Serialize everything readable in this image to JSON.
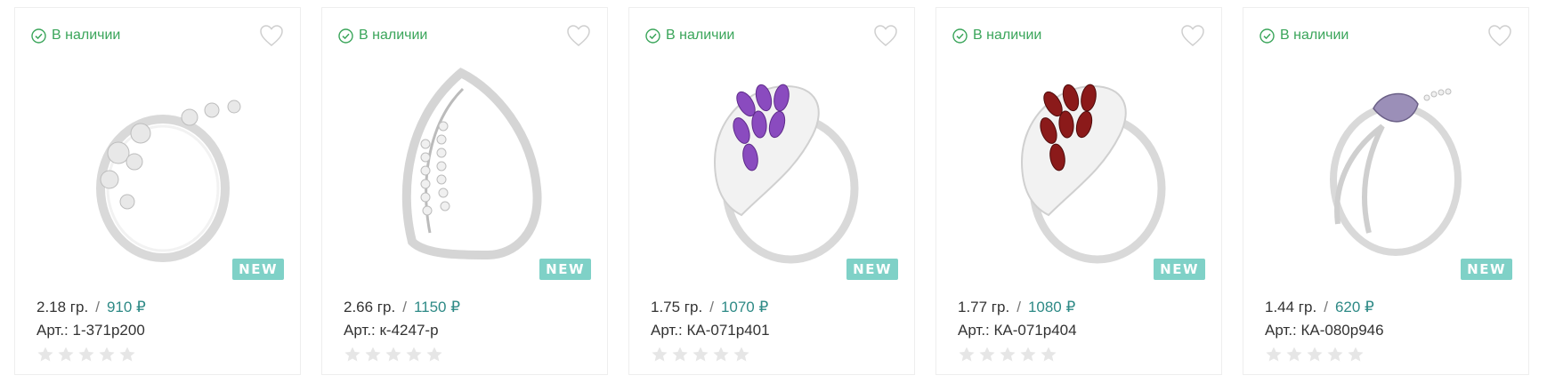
{
  "colors": {
    "in_stock": "#3aa55a",
    "price": "#2e8a86",
    "badge_bg": "#7fd1c7",
    "star_empty": "#e6e6e6"
  },
  "products": [
    {
      "stock": "В наличии",
      "badge": "NEW",
      "weight": "2.18 гр.",
      "separator": "/",
      "price": "910 ₽",
      "article": "Арт.: 1-371р200",
      "rating": 0,
      "stone_color": "#e8e8e8",
      "icon": "heart-icon"
    },
    {
      "stock": "В наличии",
      "badge": "NEW",
      "weight": "2.66 гр.",
      "separator": "/",
      "price": "1150 ₽",
      "article": "Арт.: к-4247-р",
      "rating": 0,
      "stone_color": "#e8e8e8",
      "icon": "heart-icon"
    },
    {
      "stock": "В наличии",
      "badge": "NEW",
      "weight": "1.75 гр.",
      "separator": "/",
      "price": "1070 ₽",
      "article": "Арт.: КА-071р401",
      "rating": 0,
      "stone_color": "#8a4bbf",
      "icon": "heart-icon"
    },
    {
      "stock": "В наличии",
      "badge": "NEW",
      "weight": "1.77 гр.",
      "separator": "/",
      "price": "1080 ₽",
      "article": "Арт.: КА-071р404",
      "rating": 0,
      "stone_color": "#8b1a1a",
      "icon": "heart-icon"
    },
    {
      "stock": "В наличии",
      "badge": "NEW",
      "weight": "1.44 гр.",
      "separator": "/",
      "price": "620 ₽",
      "article": "Арт.: КА-080р946",
      "rating": 0,
      "stone_color": "#9b8fb8",
      "icon": "heart-icon"
    }
  ]
}
